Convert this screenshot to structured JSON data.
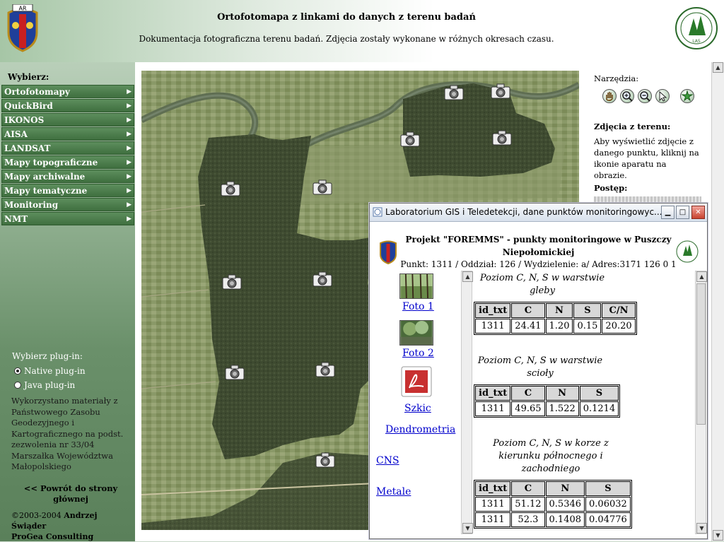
{
  "header": {
    "title": "Ortofotomapa z linkami do danych z terenu badań",
    "subtitle": "Dokumentacja fotograficzna terenu badań. Zdjęcia zostały wykonane w różnych okresach czasu.",
    "logo_left_text": "AR",
    "logo_right_text": "LAS"
  },
  "sidebar": {
    "choose_label": "Wybierz:",
    "items": [
      {
        "label": "Ortofotomapy"
      },
      {
        "label": "QuickBird"
      },
      {
        "label": "IKONOS"
      },
      {
        "label": "AISA"
      },
      {
        "label": "LANDSAT"
      },
      {
        "label": "Mapy topograficzne"
      },
      {
        "label": "Mapy archiwalne"
      },
      {
        "label": "Mapy tematyczne"
      },
      {
        "label": "Monitoring"
      },
      {
        "label": "NMT"
      }
    ],
    "plugin_label": "Wybierz plug-in:",
    "plugins": [
      {
        "label": "Native plug-in",
        "selected": true
      },
      {
        "label": "Java plug-in",
        "selected": false
      }
    ],
    "credits": "Wykorzystano materiały z Państwowego Zasobu Geodezyjnego i Kartograficznego na podst. zezwolenia nr 33/04 Marszałka Województwa Małopolskiego",
    "back_link": "<< Powrót do strony głównej",
    "copyright_prefix": "©2003-2004 ",
    "copyright_author": "Andrzej Świąder",
    "copyright_company": "ProGea Consulting"
  },
  "tools": {
    "label": "Narzędzia:",
    "icons": [
      "pan-icon",
      "zoom-in-icon",
      "zoom-out-icon",
      "pointer-icon",
      "full-extent-icon"
    ],
    "photos_label": "Zdjęcia z terenu:",
    "photos_text": "Aby wyświetlić zdjęcie z danego punktu, kliknij na ikonie aparatu na obrazie.",
    "progress_label": "Postęp:"
  },
  "popup": {
    "title": "Laboratorium GIS i Teledetekcji, dane punktów monitoringowyc...",
    "heading": "Projekt \"FOREMMS\" - punkty monitoringowe w Puszczy Niepołomickiej",
    "subheading": "Punkt: 1311 / Oddział: 126 / Wydzielenie: a/ Adres:3171 126 0 1",
    "links": [
      "Foto 1",
      "Foto 2",
      "Szkic",
      "Dendrometria",
      "CNS",
      "Metale"
    ],
    "sections": [
      {
        "title": "Poziom C, N, S w warstwie gleby",
        "headers": [
          "id_txt",
          "C",
          "N",
          "S",
          "C/N"
        ],
        "rows": [
          [
            "1311",
            "24.41",
            "1.20",
            "0.15",
            "20.20"
          ]
        ]
      },
      {
        "title": "Poziom C, N, S w warstwie scioły",
        "headers": [
          "id_txt",
          "C",
          "N",
          "S"
        ],
        "rows": [
          [
            "1311",
            "49.65",
            "1.522",
            "0.1214"
          ]
        ]
      },
      {
        "title": "Poziom C, N, S w korze z kierunku północnego i zachodniego",
        "headers": [
          "id_txt",
          "C",
          "N",
          "S"
        ],
        "rows": [
          [
            "1311",
            "51.12",
            "0.5346",
            "0.06032"
          ],
          [
            "1311",
            "52.3",
            "0.1408",
            "0.04776"
          ]
        ]
      }
    ]
  },
  "colors": {
    "menu_bg": "#4a7b4a",
    "link": "#0000cc",
    "forest": "#3d4a2c"
  }
}
